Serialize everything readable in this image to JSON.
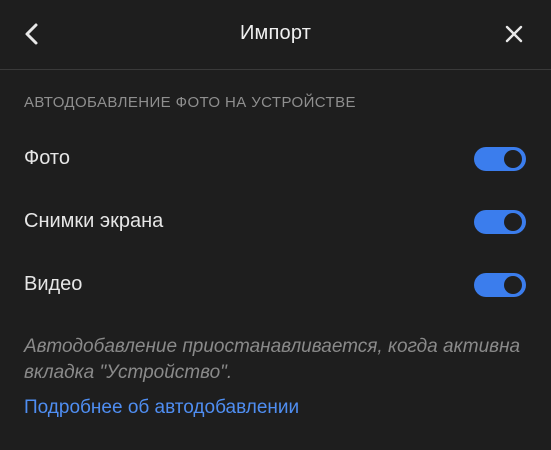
{
  "header": {
    "title": "Импорт"
  },
  "section": {
    "title": "АВТОДОБАВЛЕНИЕ ФОТО НА УСТРОЙСТВЕ"
  },
  "settings": [
    {
      "label": "Фото",
      "enabled": true
    },
    {
      "label": "Снимки экрана",
      "enabled": true
    },
    {
      "label": "Видео",
      "enabled": true
    }
  ],
  "note": "Автодобавление приостанавливается, когда активна вкладка \"Устройство\".",
  "link": "Подробнее об автодобавлении",
  "colors": {
    "background": "#1e1e1e",
    "accent": "#3b7ded",
    "link": "#4f8ef2"
  }
}
